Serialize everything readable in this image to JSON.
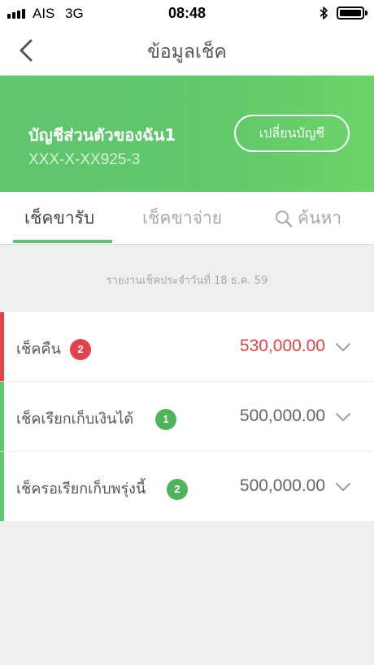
{
  "status_bar": {
    "carrier": "AIS",
    "network": "3G",
    "time": "08:48"
  },
  "nav": {
    "title": "ข้อมูลเช็ค"
  },
  "account": {
    "name": "บัญชีส่วนตัวของฉัน1",
    "number": "XXX-X-XX925-3",
    "switch_label": "เปลี่ยนบัญชี"
  },
  "tabs": {
    "receive": "เช็คขารับ",
    "pay": "เช็คขาจ่าย",
    "search": "ค้นหา"
  },
  "report": {
    "date_text": "รายงานเช็คประจำวันที่ 18 ธ.ค. 59"
  },
  "colors": {
    "accent_green": "#5ec66c",
    "returned_red": "#e0434a",
    "amount_gray": "#5f6670"
  },
  "checks": [
    {
      "label": "เช็คคืน",
      "badge": "2",
      "amount": "530,000.00",
      "status": "returned"
    },
    {
      "label": "เช็คเรียกเก็บเงินได้",
      "badge": "1",
      "amount": "500,000.00",
      "status": "cleared"
    },
    {
      "label": "เช็ครอเรียกเก็บพรุ่งนี้",
      "badge": "2",
      "amount": "500,000.00",
      "status": "pending"
    }
  ]
}
